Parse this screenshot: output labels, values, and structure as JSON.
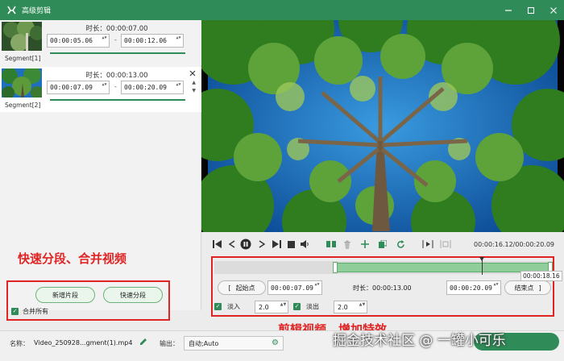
{
  "window": {
    "title": "高级剪辑",
    "accent": "#2f8b57"
  },
  "segments": [
    {
      "label": "Segment[1]",
      "duration_label": "时长：00:00:07.00",
      "start": "00:00:05.06",
      "end": "00:00:12.06"
    },
    {
      "label": "Segment[2]",
      "duration_label": "时长：00:00:13.00",
      "start": "00:00:07.09",
      "end": "00:00:20.09"
    }
  ],
  "left_actions": {
    "add_segment": "新增片段",
    "quick_split": "快速分段",
    "merge_all": "合并所有",
    "merge_all_checked": true
  },
  "annotations": {
    "left": "快速分段、合并视频",
    "right": "剪辑视频、增加特效"
  },
  "player": {
    "timecode": "00:00:16.12/00:00:20.09",
    "playhead_fraction": 0.8
  },
  "edit": {
    "tooltip_time": "00:00:18.16",
    "selection_start_fraction": 0.35,
    "selection_end_fraction": 1.0,
    "start_button": "起始点",
    "start_time": "00:00:07.09",
    "duration_label": "时长：00:00:13.00",
    "end_time": "00:00:20.09",
    "end_button": "结束点",
    "fade_in_label": "淡入",
    "fade_in_value": "2.0",
    "fade_in_checked": true,
    "fade_out_label": "淡出",
    "fade_out_value": "2.0",
    "fade_out_checked": true
  },
  "footer": {
    "name_label": "名称：",
    "name_value": "Video_250928...gment(1).mp4",
    "output_label": "输出：",
    "output_value": "自动;Auto",
    "watermark": "掘金技术社区 @ 一罐小可乐"
  }
}
